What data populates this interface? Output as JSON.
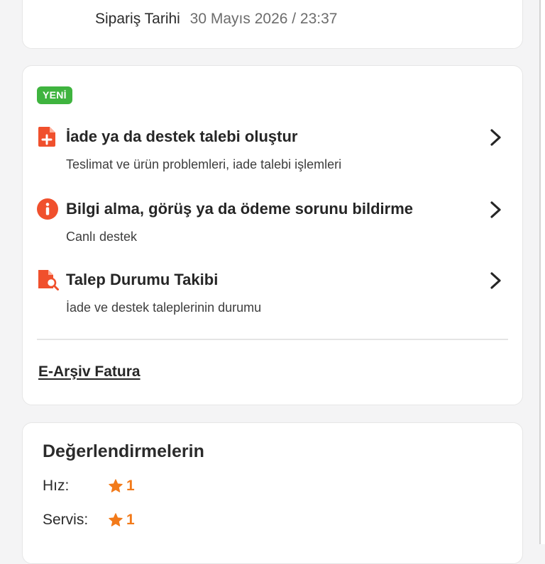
{
  "order": {
    "date_label": "Sipariş Tarihi",
    "date_value": "30 Mayıs 2026 / 23:37"
  },
  "support": {
    "badge": "YENİ",
    "items": [
      {
        "icon": "document-plus-icon",
        "title": "İade ya da destek talebi oluştur",
        "subtitle": "Teslimat ve ürün problemleri, iade talebi işlemleri"
      },
      {
        "icon": "info-circle-icon",
        "title": "Bilgi alma, görüş ya da ödeme sorunu bildirme",
        "subtitle": "Canlı destek"
      },
      {
        "icon": "document-search-icon",
        "title": "Talep Durumu Takibi",
        "subtitle": "İade ve destek taleplerinin durumu"
      }
    ],
    "invoice_link": "E-Arşiv Fatura"
  },
  "ratings": {
    "title": "Değerlendirmelerin",
    "items": [
      {
        "label": "Hız:",
        "value": "1",
        "icon": "star-icon"
      },
      {
        "label": "Servis:",
        "value": "1",
        "icon": "star-icon"
      }
    ]
  },
  "colors": {
    "accent": "#f27a1a",
    "icon_red": "#f0502d",
    "badge_green": "#3fb43f",
    "card_border": "#e6e6e6",
    "background": "#f4f4f5"
  }
}
